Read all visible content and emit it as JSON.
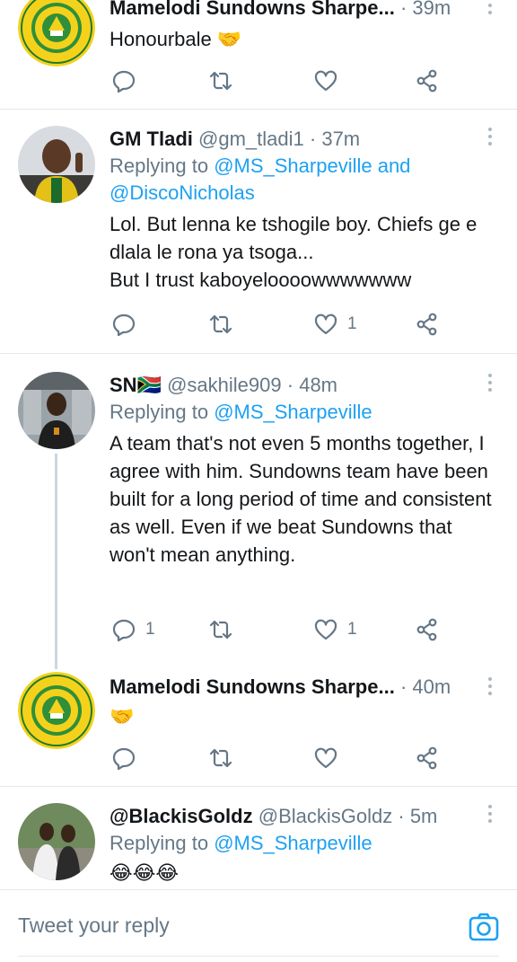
{
  "colors": {
    "link": "#1da1f2",
    "secondary": "#657786",
    "divider": "#e1e8ed",
    "text": "#14171a"
  },
  "tweets": [
    {
      "display_name": "Mamelodi Sundowns Sharpe...",
      "handle": "",
      "time": "39m",
      "replying_prefix": "",
      "mentions": "",
      "mentions2": "",
      "text": "Honourbale 🤝",
      "counts": {
        "reply": "",
        "like": ""
      },
      "avatar_icon": "sundowns-crest-icon"
    },
    {
      "display_name": "GM Tladi",
      "handle": "@gm_tladi1",
      "time": "37m",
      "replying_prefix": "Replying to ",
      "mentions": "@MS_Sharpeville and",
      "mentions2": "@DiscoNicholas",
      "text": "Lol. But lenna ke tshogile boy.  Chiefs ge e dlala le rona ya tsoga...\nBut I trust kaboyeloooowwwwwww",
      "counts": {
        "reply": "",
        "like": "1"
      },
      "avatar_icon": "user-photo-avatar"
    },
    {
      "display_name": "SN🇿🇦",
      "handle": "@sakhile909",
      "time": "48m",
      "replying_prefix": "Replying to ",
      "mentions": "@MS_Sharpeville",
      "mentions2": "",
      "text": "A team that's not even 5 months together, I agree with him. Sundowns team have been built for a long period of time and consistent as well. Even if we beat Sundowns that won't mean anything.",
      "counts": {
        "reply": "1",
        "like": "1"
      },
      "avatar_icon": "user-photo-avatar"
    },
    {
      "display_name": "Mamelodi Sundowns Sharpe...",
      "handle": "",
      "time": "40m",
      "replying_prefix": "",
      "mentions": "",
      "mentions2": "",
      "text": "🤝",
      "counts": {
        "reply": "",
        "like": ""
      },
      "avatar_icon": "sundowns-crest-icon"
    },
    {
      "display_name": "@BlackisGoldz",
      "handle": "@BlackisGoldz",
      "time": "5m",
      "replying_prefix": "Replying to ",
      "mentions": "@MS_Sharpeville",
      "mentions2": "",
      "text": "😂😂😂",
      "counts": {
        "reply": "",
        "like": ""
      },
      "avatar_icon": "user-photo-avatar"
    }
  ],
  "crest": {
    "top": "SHARPEVILLE",
    "bottom": "BRANCH",
    "left": "MAMELODI",
    "right": "SUNDOWNS"
  },
  "composer": {
    "placeholder": "Tweet your reply"
  },
  "meta": {
    "dot": "·"
  }
}
